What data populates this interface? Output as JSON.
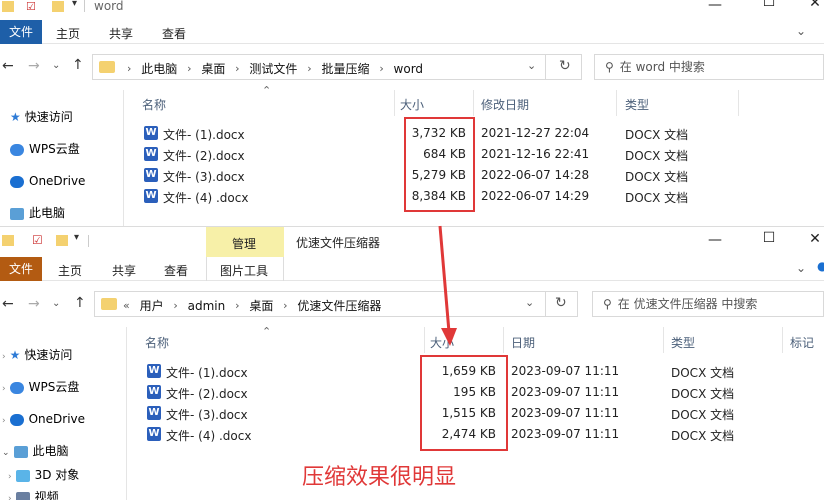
{
  "window1": {
    "title": "word",
    "ribbon_tabs": [
      "文件",
      "主页",
      "共享",
      "查看"
    ],
    "breadcrumb": [
      "此电脑",
      "桌面",
      "测试文件",
      "批量压缩",
      "word"
    ],
    "search_placeholder": "在 word 中搜索",
    "nav_items": [
      "快速访问",
      "WPS云盘",
      "OneDrive",
      "此电脑"
    ],
    "columns": [
      "名称",
      "大小",
      "修改日期",
      "类型"
    ],
    "files": [
      {
        "name": "文件- (1).docx",
        "size": "3,732 KB",
        "date": "2021-12-27 22:04",
        "type": "DOCX 文档"
      },
      {
        "name": "文件- (2).docx",
        "size": "684 KB",
        "date": "2021-12-16 22:41",
        "type": "DOCX 文档"
      },
      {
        "name": "文件- (3).docx",
        "size": "5,279 KB",
        "date": "2022-06-07 14:28",
        "type": "DOCX 文档"
      },
      {
        "name": "文件- (4) .docx",
        "size": "8,384 KB",
        "date": "2022-06-07 14:29",
        "type": "DOCX 文档"
      }
    ]
  },
  "window2": {
    "title": "优速文件压缩器",
    "context_tab": "管理",
    "context_subtab": "图片工具",
    "ribbon_tabs": [
      "文件",
      "主页",
      "共享",
      "查看"
    ],
    "breadcrumb_prefix": "«",
    "breadcrumb": [
      "用户",
      "admin",
      "桌面",
      "优速文件压缩器"
    ],
    "search_placeholder": "在 优速文件压缩器 中搜索",
    "nav_items": [
      "快速访问",
      "WPS云盘",
      "OneDrive",
      "此电脑",
      "3D 对象",
      "视频"
    ],
    "columns": [
      "名称",
      "大小",
      "日期",
      "类型",
      "标记"
    ],
    "files": [
      {
        "name": "文件- (1).docx",
        "size": "1,659 KB",
        "date": "2023-09-07 11:11",
        "type": "DOCX 文档"
      },
      {
        "name": "文件- (2).docx",
        "size": "195 KB",
        "date": "2023-09-07 11:11",
        "type": "DOCX 文档"
      },
      {
        "name": "文件- (3).docx",
        "size": "1,515 KB",
        "date": "2023-09-07 11:11",
        "type": "DOCX 文档"
      },
      {
        "name": "文件- (4) .docx",
        "size": "2,474 KB",
        "date": "2023-09-07 11:11",
        "type": "DOCX 文档"
      }
    ]
  },
  "annotation": "压缩效果很明显",
  "colors": {
    "highlight": "#e03838",
    "accent": "#1e5fa8",
    "context_tab": "#f7f0a8"
  }
}
